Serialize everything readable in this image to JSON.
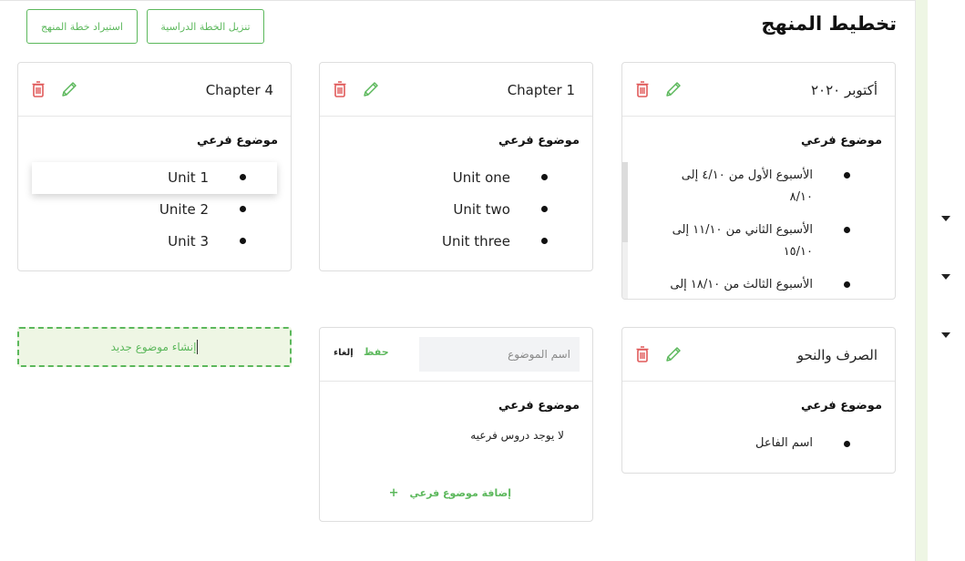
{
  "page": {
    "title": "تخطيط المنهج",
    "export_plan_label": "تنزيل الخطة الدراسية",
    "import_plan_label": "استيراد خطة المنهج",
    "new_topic_label": "إنشاء موضوع جديد"
  },
  "colors": {
    "accent": "#5cb85c",
    "danger": "#e05a5a",
    "accent_bg": "#eef6e4"
  },
  "cards": {
    "october": {
      "title": "أكتوبر ٢٠٢٠",
      "sub_heading": "موضوع فرعي",
      "items": [
        "الأسبوع الأول من ٤/١٠ إلى ٨/١٠",
        "الأسبوع الثاني من ١١/١٠ إلى ١٥/١٠",
        "الأسبوع الثالث من ١٨/١٠ إلى"
      ]
    },
    "chapter1": {
      "title": "Chapter 1",
      "sub_heading": "موضوع فرعي",
      "items": [
        "Unit one",
        "Unit two",
        "Unit three"
      ]
    },
    "chapter4": {
      "title": "Chapter 4",
      "sub_heading": "موضوع فرعي",
      "items": [
        "Unit 1",
        "Unite 2",
        "Unit 3"
      ]
    },
    "grammar": {
      "title": "الصرف والنحو",
      "sub_heading": "موضوع فرعي",
      "items": [
        "اسم الفاعل"
      ]
    },
    "new_card": {
      "input_placeholder": "اسم الموضوع",
      "input_value": "",
      "save_label": "حفظ",
      "cancel_label": "إلغاء",
      "sub_heading": "موضوع فرعي",
      "empty_text": "لا يوجد دروس فرعيه",
      "add_sub_label": "إضافة موضوع فرعي",
      "add_sub_icon": "+"
    }
  },
  "icons": [
    "trash-icon",
    "pencil-icon",
    "caret-down-icon"
  ]
}
